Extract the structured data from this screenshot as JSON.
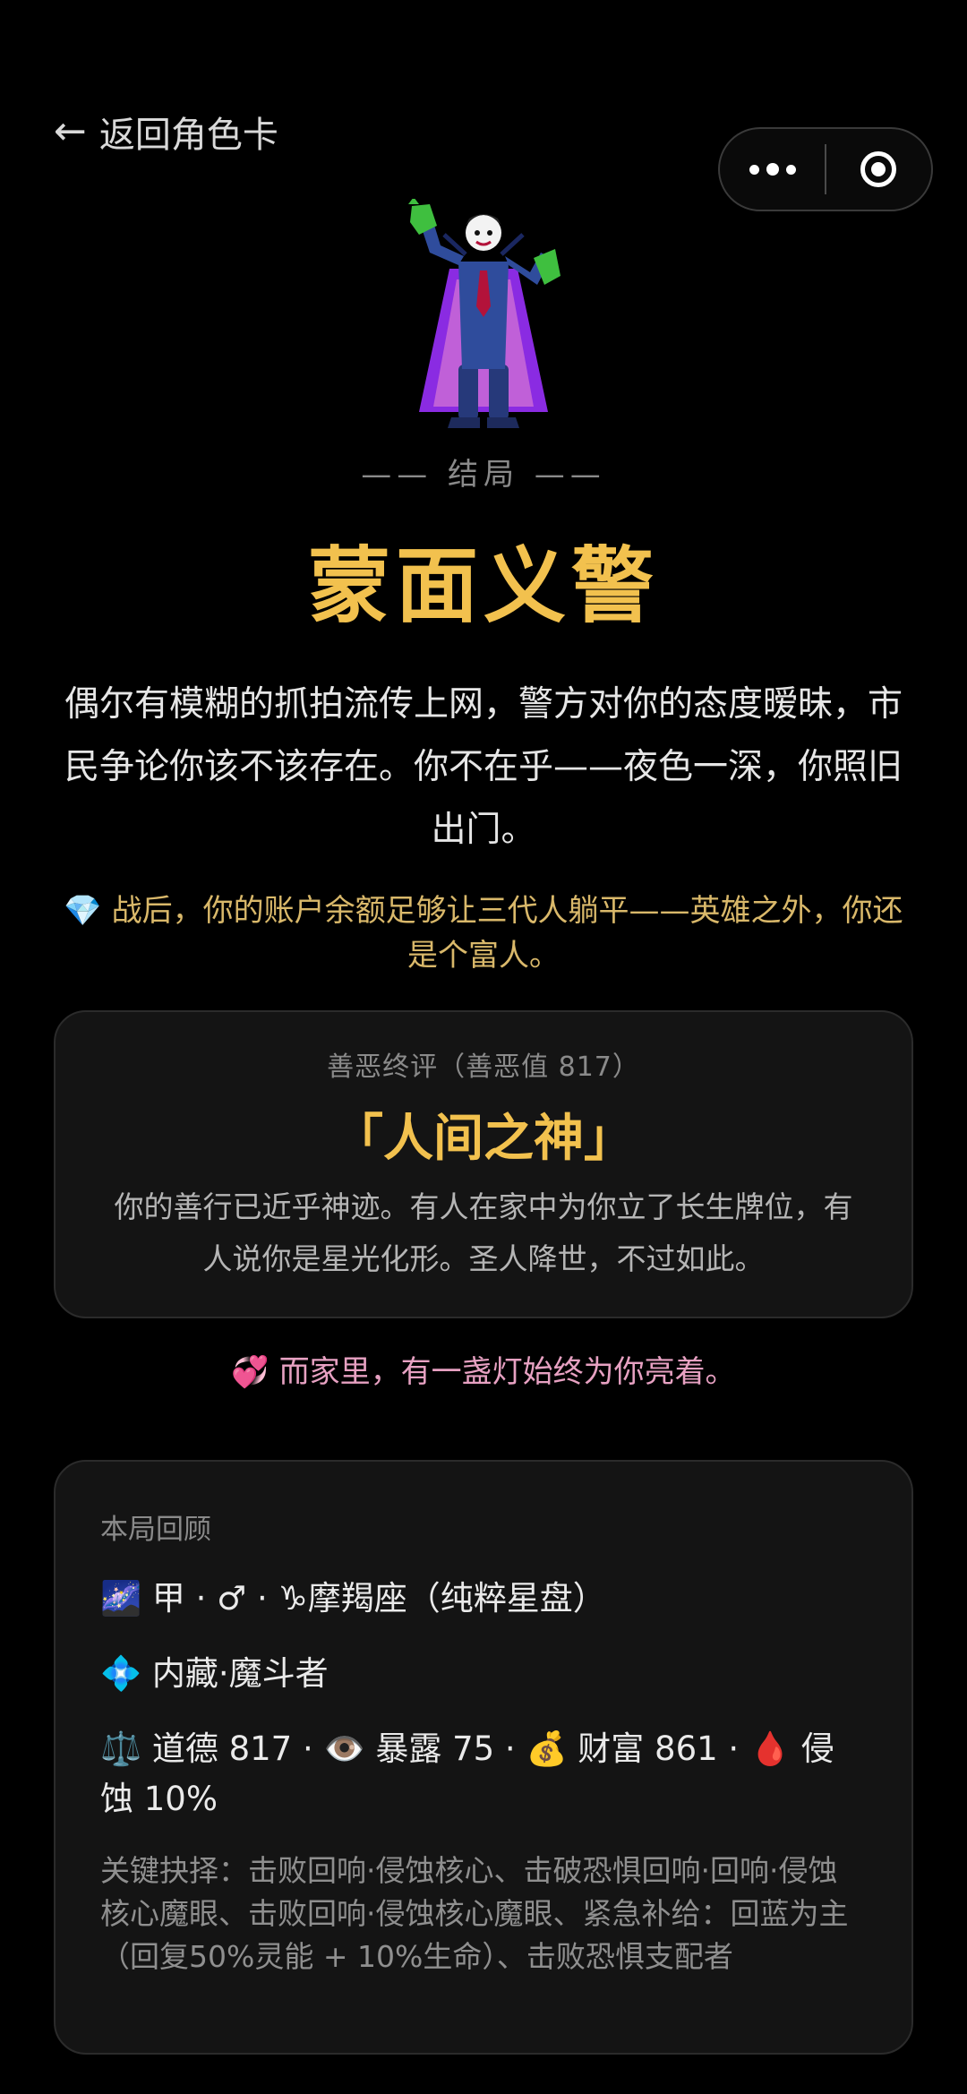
{
  "nav": {
    "back_label": "返回角色卡",
    "back_arrow": "←"
  },
  "capsule": {
    "more_icon": "more-dots-icon",
    "close_icon": "target-close-icon"
  },
  "ending": {
    "label": "—— 结局 ——",
    "title": "蒙面义警",
    "description": "偶尔有模糊的抓拍流传上网，警方对你的态度暧昧，市民争论你该不该存在。你不在乎——夜色一深，你照旧出门。",
    "wealth_note": "💎 战后，你的账户余额足够让三代人躺平——英雄之外，你还是个富人。"
  },
  "judgement": {
    "caption": "善恶终评（善恶值 817）",
    "title": "「人间之神」",
    "description": "你的善行已近乎神迹。有人在家中为你立了长生牌位，有人说你是星光化形。圣人降世，不过如此。"
  },
  "home_note": "💞 而家里，有一盏灯始终为你亮着。",
  "review": {
    "caption": "本局回顾",
    "line1": "🌌 甲 · ♂ · ♑摩羯座（纯粹星盘）",
    "line2": "💠 内藏·魔斗者",
    "line3": "⚖️ 道德 817 · 👁️ 暴露 75 · 💰 财富 861 · 🩸 侵蚀 10%",
    "choices": "关键抉择：击败回响·侵蚀核心、击破恐惧回响·回响·侵蚀核心魔眼、击败回响·侵蚀核心魔眼、紧急补给：回蓝为主（回复50%灵能 + 10%生命）、击败恐惧支配者"
  },
  "colors": {
    "background": "#000000",
    "gold": "#f2c14e",
    "card": "#141414",
    "pink": "#e7a1c2",
    "wealth": "#d9b86a"
  }
}
